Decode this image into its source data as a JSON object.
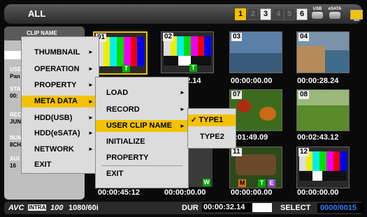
{
  "header": {
    "title": "ALL",
    "slots": [
      {
        "label": "1",
        "state": "active"
      },
      {
        "label": "2",
        "state": "off"
      },
      {
        "label": "3",
        "state": "on"
      },
      {
        "label": "4",
        "state": "off"
      },
      {
        "label": "5",
        "state": "off"
      },
      {
        "label": "6",
        "state": "on"
      }
    ],
    "usb_label": "USB",
    "esata_label": "eSATA"
  },
  "info_panel": {
    "clip_name_label": "CLIP NAME",
    "user_label": "USE",
    "user_value": "Pan",
    "start_label": "STA",
    "start_value": "00:",
    "rec_label": "REC",
    "rec_value": "JUN",
    "num_label": "NUM",
    "num_value": "8CH",
    "audio_label": "AUI",
    "audio_value": "16"
  },
  "main_menu": {
    "items": [
      "THUMBNAIL",
      "OPERATION",
      "PROPERTY",
      "META DATA",
      "HDD(USB)",
      "HDD(eSATA)",
      "NETWORK",
      "EXIT"
    ],
    "selected": "META DATA"
  },
  "metadata_menu": {
    "items": [
      "LOAD",
      "RECORD",
      "USER CLIP NAME",
      "INITIALIZE",
      "PROPERTY",
      "EXIT"
    ],
    "selected": "USER CLIP NAME"
  },
  "clipname_menu": {
    "items": [
      "TYPE1",
      "TYPE2"
    ],
    "checked": "TYPE1",
    "check_mark": "✓"
  },
  "thumbnails": [
    {
      "num": "01",
      "timecode": ""
    },
    {
      "num": "02",
      "timecode": "32.14"
    },
    {
      "num": "03",
      "timecode": "00:00:00.00"
    },
    {
      "num": "04",
      "timecode": "00:00:28.24"
    },
    {
      "num": "07",
      "timecode": "0:01:49.09"
    },
    {
      "num": "08",
      "timecode": "00:02:43.12"
    },
    {
      "num": "11",
      "timecode": ""
    },
    {
      "num": "12",
      "timecode": "00:00:00.00"
    }
  ],
  "bottom_timecodes": [
    "00:00:45:12",
    "00:00:00.00",
    "00:00:00.00",
    "00:00:00.00"
  ],
  "badges": {
    "t": "T",
    "w": "W",
    "m": "M",
    "e": "E"
  },
  "status": {
    "format_logo": "AVC",
    "format_logo2": "INTRA",
    "format_code": "100",
    "format": "1080/60i",
    "dur_label": "DUR",
    "dur_value": "00:00:32.14",
    "dur_progress": 0.05,
    "select_label": "SELECT",
    "select_value": "0000/0015"
  },
  "colors": {
    "accent": "#f2c200",
    "menu_bg": "#dcdcdc",
    "select_value": "#3a7dff"
  }
}
